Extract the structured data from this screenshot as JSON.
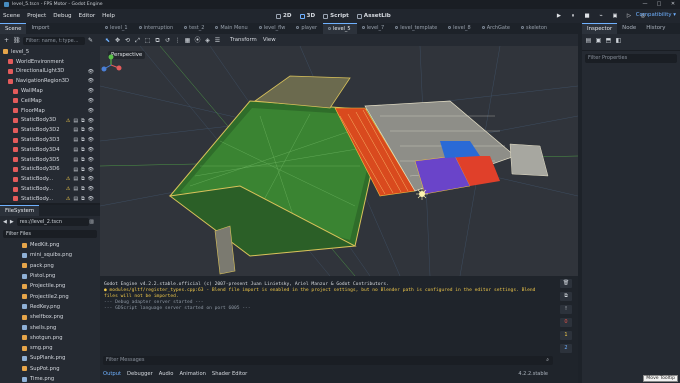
{
  "window": {
    "title": "level_5.tscn - FPS Motor - Godot Engine",
    "minimize": "—",
    "maximize": "□",
    "close": "✕"
  },
  "menu": [
    "Scene",
    "Project",
    "Debug",
    "Editor",
    "Help"
  ],
  "workspaces": [
    {
      "label": "2D",
      "active": false
    },
    {
      "label": "3D",
      "active": true
    },
    {
      "label": "Script",
      "active": false
    },
    {
      "label": "AssetLib",
      "active": false
    }
  ],
  "run_buttons": [
    "▶",
    "⏸",
    "■",
    "⌁",
    "▣",
    "▷",
    "◎"
  ],
  "renderer": "Compatibility ▾",
  "left_dock": {
    "tabs": [
      "Scene",
      "Import"
    ],
    "filter_placeholder": "Filter: name, t:type...",
    "tree": [
      {
        "label": "level_5",
        "depth": 0,
        "color": "#e6a54a",
        "selected": false,
        "flags": []
      },
      {
        "label": "WorldEnvironment",
        "depth": 1,
        "color": "#e45b5b",
        "selected": false,
        "flags": []
      },
      {
        "label": "DirectionalLight3D",
        "depth": 1,
        "color": "#e45b5b",
        "selected": false,
        "flags": [
          "👁"
        ]
      },
      {
        "label": "NavigationRegion3D",
        "depth": 1,
        "color": "#e45b5b",
        "selected": false,
        "flags": [
          "👁"
        ]
      },
      {
        "label": "WallMap",
        "depth": 2,
        "color": "#e45b5b",
        "selected": false,
        "flags": [
          "👁"
        ]
      },
      {
        "label": "CeilMap",
        "depth": 2,
        "color": "#e45b5b",
        "selected": false,
        "flags": [
          "👁"
        ]
      },
      {
        "label": "FloorMap",
        "depth": 2,
        "color": "#e45b5b",
        "selected": false,
        "flags": [
          "👁"
        ]
      },
      {
        "label": "StaticBody3D",
        "depth": 2,
        "color": "#e45b5b",
        "selected": false,
        "flags": [
          "⚠",
          "▤",
          "⧉",
          "👁"
        ]
      },
      {
        "label": "StaticBody3D2",
        "depth": 2,
        "color": "#e45b5b",
        "selected": false,
        "flags": [
          "▤",
          "⧉",
          "👁"
        ]
      },
      {
        "label": "StaticBody3D3",
        "depth": 2,
        "color": "#e45b5b",
        "selected": false,
        "flags": [
          "▤",
          "⧉",
          "👁"
        ]
      },
      {
        "label": "StaticBody3D4",
        "depth": 2,
        "color": "#e45b5b",
        "selected": false,
        "flags": [
          "▤",
          "⧉",
          "👁"
        ]
      },
      {
        "label": "StaticBody3D5",
        "depth": 2,
        "color": "#e45b5b",
        "selected": false,
        "flags": [
          "▤",
          "⧉",
          "👁"
        ]
      },
      {
        "label": "StaticBody3D6",
        "depth": 2,
        "color": "#e45b5b",
        "selected": false,
        "flags": [
          "▤",
          "⧉",
          "👁"
        ]
      },
      {
        "label": "StaticBody...",
        "depth": 2,
        "color": "#e45b5b",
        "selected": false,
        "flags": [
          "⚠",
          "▤",
          "⧉",
          "👁"
        ]
      },
      {
        "label": "StaticBody...",
        "depth": 2,
        "color": "#e45b5b",
        "selected": false,
        "flags": [
          "⚠",
          "▤",
          "⧉",
          "👁"
        ]
      },
      {
        "label": "StaticBody...",
        "depth": 2,
        "color": "#e45b5b",
        "selected": false,
        "flags": [
          "⚠",
          "▤",
          "⧉",
          "👁"
        ]
      }
    ],
    "filesystem_title": "FileSystem",
    "path": "res://level_2.tscn",
    "filter_files": "Filter Files",
    "files": [
      "MedKit.png",
      "mini_squibs.png",
      "pack.png",
      "Pistol.png",
      "Projectile.png",
      "Projectile2.png",
      "RedKey.png",
      "shelfbox.png",
      "shells.png",
      "shotgun.png",
      "smg.png",
      "SupPlank.png",
      "SupPot.png",
      "Time.png"
    ]
  },
  "scene_tabs": [
    {
      "label": "level_1",
      "active": false
    },
    {
      "label": "interruption",
      "active": false
    },
    {
      "label": "test_2",
      "active": false
    },
    {
      "label": "Main Menu",
      "active": false
    },
    {
      "label": "level_flw",
      "active": false
    },
    {
      "label": "player",
      "active": false
    },
    {
      "label": "level_5",
      "active": true
    },
    {
      "label": "level_7",
      "active": false
    },
    {
      "label": "level_template",
      "active": false
    },
    {
      "label": "level_8",
      "active": false
    },
    {
      "label": "ArchGate",
      "active": false
    },
    {
      "label": "skeleton",
      "active": false
    }
  ],
  "viewport": {
    "toolbar_icons": [
      "⬉",
      "✥",
      "⟲",
      "⤢",
      "⬚",
      "⧉",
      "↺",
      "⋮",
      "▦",
      "⦿",
      "◈",
      "☰"
    ],
    "menus": [
      "Transform",
      "View"
    ],
    "perspective_label": "Perspective"
  },
  "output": {
    "lines": [
      {
        "text": "Godot Engine v4.2.2.stable.official (c) 2007-present Juan Linietsky, Ariel Manzur & Godot Contributors.",
        "kind": "normal"
      },
      {
        "text": "● modules/gltf/register_types.cpp:63 - Blend file import is enabled in the project settings, but no Blender path is configured in the editor settings. Blend",
        "kind": "warn"
      },
      {
        "text": "files will not be imported.",
        "kind": "warn"
      },
      {
        "text": "--- Debug adapter server started ---",
        "kind": "dim"
      },
      {
        "text": "--- GDScript language server started on port 6005 ---",
        "kind": "dim"
      }
    ],
    "side_buttons": [
      {
        "label": "🗑",
        "kind": "normal"
      },
      {
        "label": "⧉",
        "kind": "normal"
      },
      {
        "label": "!",
        "kind": "normal"
      },
      {
        "label": "0",
        "kind": "err"
      },
      {
        "label": "1",
        "kind": "wrn"
      },
      {
        "label": "2",
        "kind": "inf"
      }
    ],
    "filter_placeholder": "Filter Messages",
    "tabs": [
      {
        "label": "Output",
        "active": true
      },
      {
        "label": "Debugger",
        "active": false
      },
      {
        "label": "Audio",
        "active": false
      },
      {
        "label": "Animation",
        "active": false
      },
      {
        "label": "Shader Editor",
        "active": false
      }
    ],
    "version": "4.2.2.stable"
  },
  "right_dock": {
    "tabs": [
      "Inspector",
      "Node",
      "History"
    ],
    "filter_placeholder": "Filter Properties"
  },
  "tooltip": "Move Tooltip"
}
